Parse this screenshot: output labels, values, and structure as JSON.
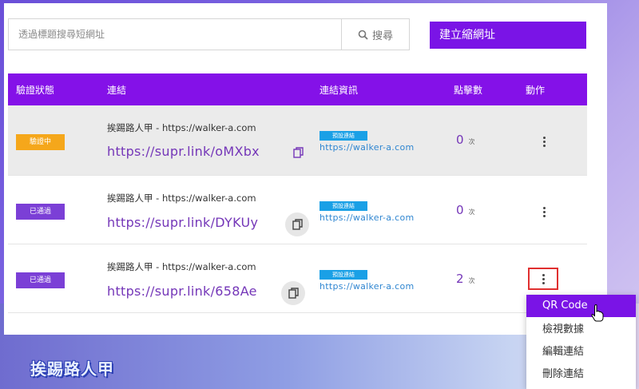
{
  "search": {
    "placeholder": "透過標題搜尋短網址",
    "button_label": "搜尋"
  },
  "create_button": "建立縮網址",
  "table": {
    "headers": [
      "驗證狀態",
      "連結",
      "連結資訊",
      "點擊數",
      "動作"
    ],
    "rows": [
      {
        "status": "驗證中",
        "title": "挨踢路人甲 - https://walker-a.com",
        "short_url": "https://supr.link/oMXbx",
        "tag": "預設連結",
        "dest": "https://walker-a.com",
        "clicks": "0",
        "unit": "次"
      },
      {
        "status": "已通過",
        "title": "挨踢路人甲 - https://walker-a.com",
        "short_url": "https://supr.link/DYKUy",
        "tag": "預設連結",
        "dest": "https://walker-a.com",
        "clicks": "0",
        "unit": "次"
      },
      {
        "status": "已通過",
        "title": "挨踢路人甲 - https://walker-a.com",
        "short_url": "https://supr.link/658Ae",
        "tag": "預設連結",
        "dest": "https://walker-a.com",
        "clicks": "2",
        "unit": "次"
      }
    ]
  },
  "menu": {
    "items": [
      "QR Code",
      "檢視數據",
      "編輯連結",
      "刪除連結"
    ]
  },
  "watermark": "挨踢路人甲",
  "colors": {
    "accent": "#7a14e6",
    "header": "#8411e8",
    "pending": "#f5a71b",
    "passed": "#7b3fd6",
    "tag": "#1aa0e6"
  }
}
